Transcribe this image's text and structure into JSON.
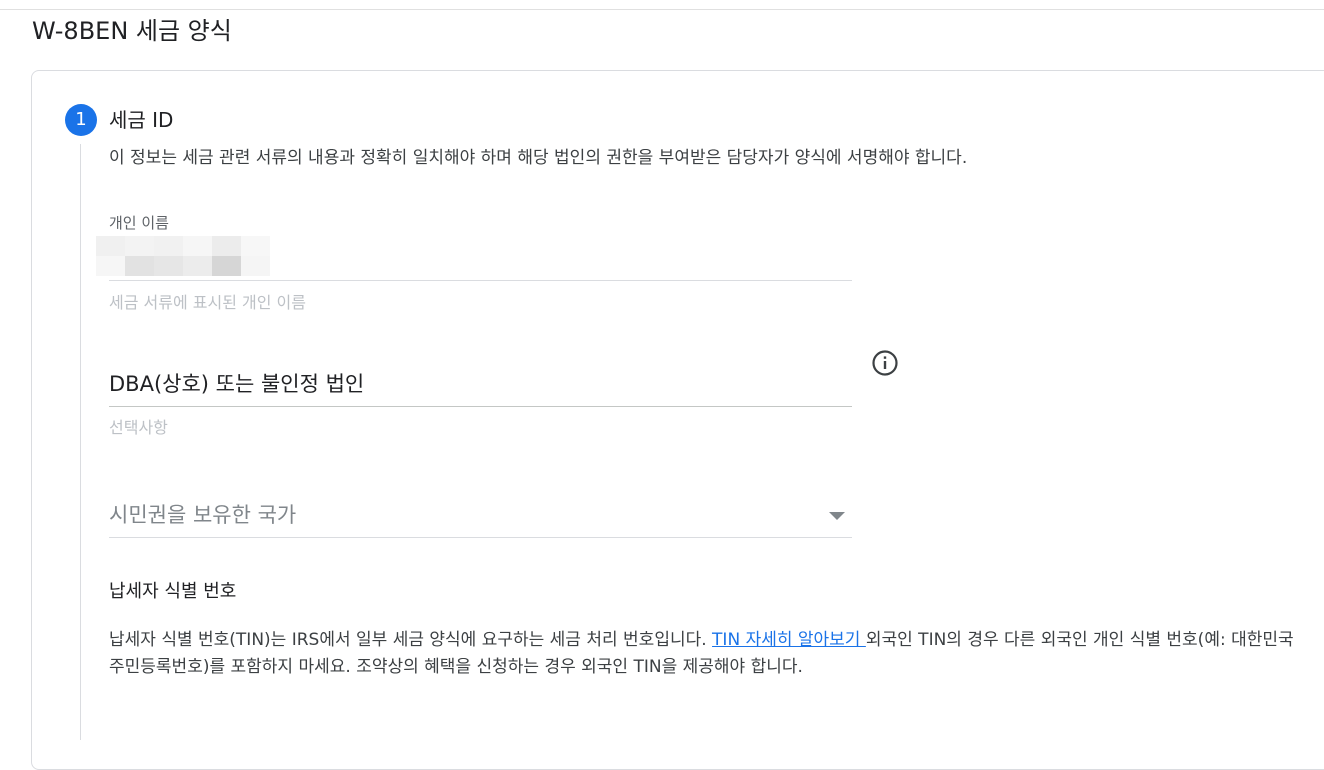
{
  "page": {
    "title": "W-8BEN 세금 양식"
  },
  "step": {
    "number": "1",
    "title": "세금 ID",
    "description": "이 정보는 세금 관련 서류의 내용과 정확히 일치해야 하며 해당 법인의 권한을 부여받은 담당자가 양식에 서명해야 합니다."
  },
  "fields": {
    "individual_name": {
      "label": "개인 이름",
      "value": "[redacted]",
      "helper": "세금 서류에 표시된 개인 이름"
    },
    "dba": {
      "label": "DBA(상호) 또는 불인정 법인",
      "helper": "선택사항",
      "icon": "info-icon"
    },
    "citizenship": {
      "label": "시민권을 보유한 국가",
      "icon": "dropdown-arrow-icon"
    }
  },
  "tin": {
    "heading": "납세자 식별 번호",
    "text_before": "납세자 식별 번호(TIN)는 IRS에서 일부 세금 양식에 요구하는 세금 처리 번호입니다. ",
    "link": "TIN 자세히 알아보기 ",
    "text_after": "외국인 TIN의 경우 다른 외국인 개인 식별 번호(예: 대한민국 주민등록번호)를 포함하지 마세요. 조약상의 혜택을 신청하는 경우 외국인 TIN을 제공해야 합니다."
  },
  "colors": {
    "accent": "#1a73e8",
    "border": "#dadce0",
    "helper_text": "#bdc1c6"
  }
}
